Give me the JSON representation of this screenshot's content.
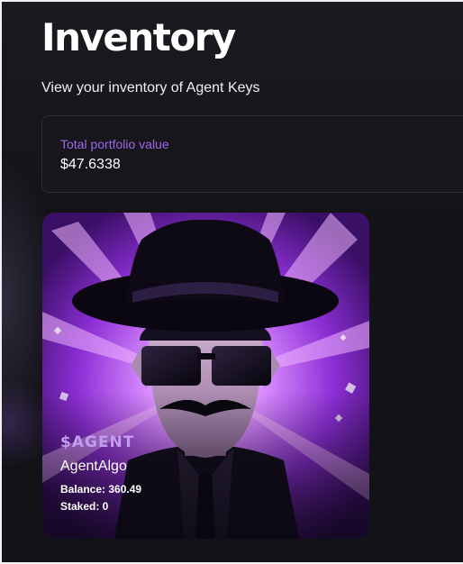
{
  "page": {
    "title": "Inventory",
    "subtitle": "View your inventory of Agent Keys"
  },
  "portfolio": {
    "label": "Total portfolio value",
    "value": "$47.6338"
  },
  "agents": [
    {
      "ticker": "$AGENT",
      "name": "AgentAlgo",
      "balance_label": "Balance: 360.49",
      "staked_label": "Staked: 0"
    }
  ],
  "colors": {
    "accent_purple": "#a067ea",
    "ticker_purple": "#c29dee",
    "background": "#121217",
    "card_border": "#2c2c34"
  }
}
